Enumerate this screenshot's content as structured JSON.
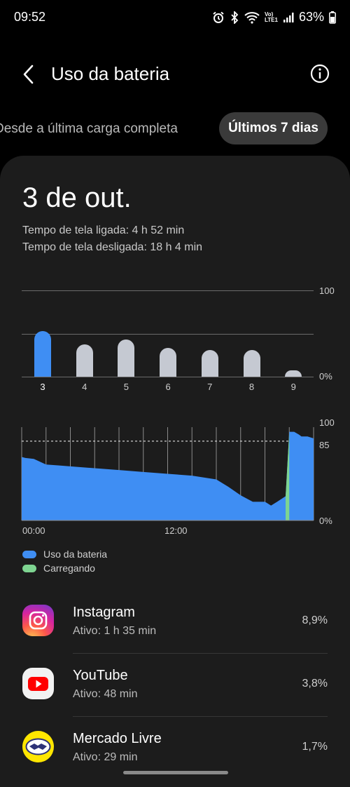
{
  "status_bar": {
    "time": "09:52",
    "battery": "63%",
    "net_top": "Vo)",
    "net_bottom": "LTE1"
  },
  "header": {
    "title": "Uso da bateria"
  },
  "tabs": [
    {
      "label": "Desde a última carga completa",
      "selected": false
    },
    {
      "label": "Últimos 7 dias",
      "selected": true
    }
  ],
  "summary": {
    "date": "3 de out.",
    "screen_on": "Tempo de tela ligada: 4 h 52 min",
    "screen_off": "Tempo de tela desligada: 18 h 4 min"
  },
  "chart_data": [
    {
      "type": "bar",
      "categories": [
        "3",
        "4",
        "5",
        "6",
        "7",
        "8",
        "9"
      ],
      "values": [
        53,
        37,
        43,
        33,
        31,
        31,
        7
      ],
      "selected_category": "3",
      "ylim": [
        0,
        100
      ],
      "ytick_labels": [
        "100",
        "0%"
      ],
      "selected_color": "#3f8ef3",
      "bar_color": "#c5c9d2"
    },
    {
      "type": "area",
      "x_tick_labels": [
        "00:00",
        "12:00"
      ],
      "y_tick_labels": [
        "100",
        "85",
        "0%"
      ],
      "ylim": [
        0,
        100
      ],
      "reference_line": 85,
      "x_hours": [
        0,
        0.3,
        1,
        2,
        3,
        4,
        6,
        8,
        10,
        12,
        14,
        16,
        17,
        18,
        19,
        20,
        20.5,
        21,
        21.7,
        22,
        22.4,
        22.8,
        23,
        23.5,
        24
      ],
      "series": [
        {
          "name": "Uso da bateria",
          "color": "#3f8ef3",
          "values": [
            68,
            67,
            66,
            60,
            59,
            58,
            56,
            54,
            52,
            50,
            48,
            44,
            36,
            27,
            20,
            20,
            16,
            20,
            26,
            95,
            95,
            92,
            90,
            90,
            88
          ]
        },
        {
          "name": "Carregando",
          "color": "#7ed491",
          "x_hours": [
            21.7,
            22
          ],
          "values": [
            26,
            95
          ]
        }
      ]
    }
  ],
  "legend": [
    {
      "label": "Uso da bateria",
      "color": "#3f8ef3"
    },
    {
      "label": "Carregando",
      "color": "#7ed491"
    }
  ],
  "apps": [
    {
      "name": "Instagram",
      "active": "Ativo: 1 h 35 min",
      "percent": "8,9%",
      "icon": "instagram-icon"
    },
    {
      "name": "YouTube",
      "active": "Ativo: 48 min",
      "percent": "3,8%",
      "icon": "youtube-icon"
    },
    {
      "name": "Mercado Livre",
      "active": "Ativo: 29 min",
      "percent": "1,7%",
      "icon": "mercado-livre-icon"
    }
  ]
}
